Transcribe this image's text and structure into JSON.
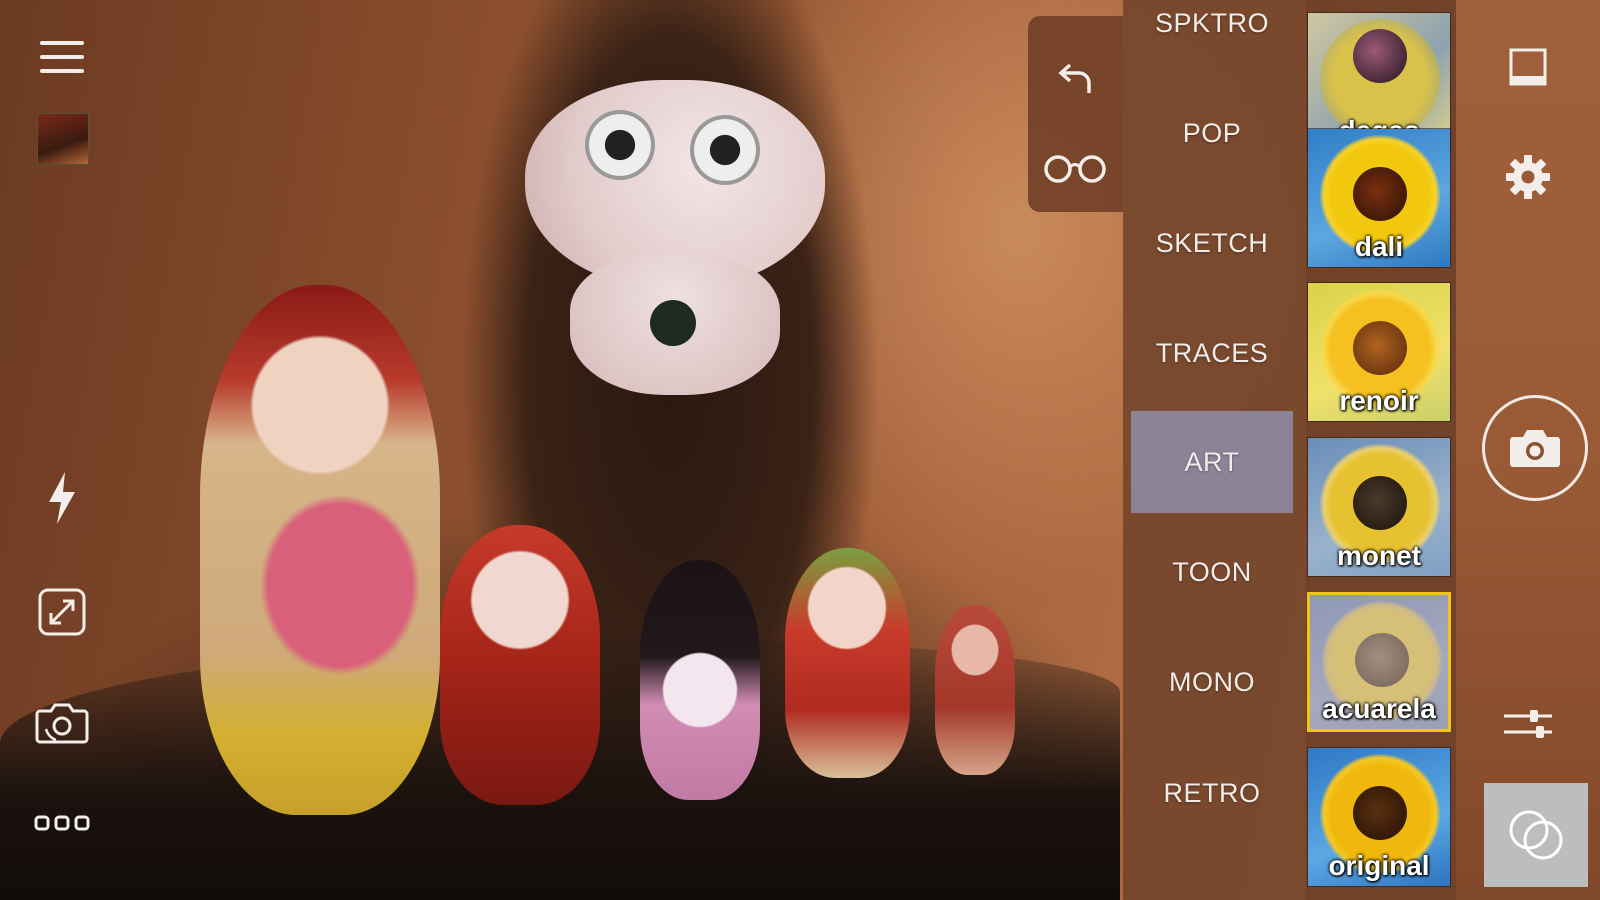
{
  "left_toolbar": {
    "menu_icon": "hamburger-menu-icon",
    "gallery_icon": "gallery-thumbnail",
    "flash_icon": "lightning-bolt-icon",
    "resize_icon": "resize-arrows-icon",
    "switch_camera_icon": "switch-camera-icon",
    "more_icon": "three-dots-icon"
  },
  "tools_panel": {
    "undo_icon": "undo-arrow-icon",
    "glasses_icon": "glasses-icon"
  },
  "categories": [
    {
      "label": "SPKTRO",
      "selected": false
    },
    {
      "label": "POP",
      "selected": false
    },
    {
      "label": "SKETCH",
      "selected": false
    },
    {
      "label": "TRACES",
      "selected": false
    },
    {
      "label": "ART",
      "selected": true
    },
    {
      "label": "TOON",
      "selected": false
    },
    {
      "label": "MONO",
      "selected": false
    },
    {
      "label": "RETRO",
      "selected": false
    }
  ],
  "effects": [
    {
      "label": "degas",
      "selected": false
    },
    {
      "label": "dali",
      "selected": false
    },
    {
      "label": "renoir",
      "selected": false
    },
    {
      "label": "monet",
      "selected": false
    },
    {
      "label": "acuarela",
      "selected": true
    },
    {
      "label": "original",
      "selected": false
    }
  ],
  "right_toolbar": {
    "aspect_icon": "aspect-ratio-icon",
    "settings_icon": "gear-icon",
    "shutter_icon": "camera-icon",
    "sliders_icon": "sliders-icon",
    "blend_icon": "overlapping-circles-icon"
  },
  "colors": {
    "selected_category_bg": "#8d8396",
    "selected_effect_border": "#f0c419"
  }
}
